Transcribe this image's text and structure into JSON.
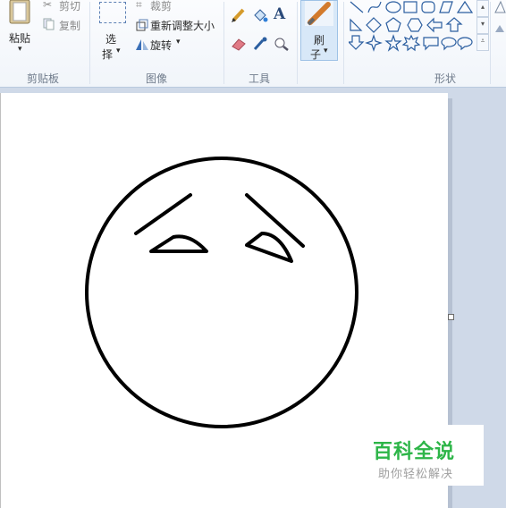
{
  "clipboard": {
    "paste_label": "粘贴",
    "cut_label": "剪切",
    "copy_label": "复制",
    "group_label": "剪贴板"
  },
  "image": {
    "select_label_1": "选",
    "select_label_2": "择",
    "crop_label": "裁剪",
    "resize_label": "重新调整大小",
    "rotate_label": "旋转",
    "group_label": "图像"
  },
  "tools": {
    "group_label": "工具",
    "icons": [
      "pencil-icon",
      "fill-icon",
      "text-icon",
      "eraser-icon",
      "color-picker-icon",
      "magnifier-icon"
    ]
  },
  "brushes": {
    "label_1": "刷",
    "label_2": "子"
  },
  "shapes": {
    "group_label": "形状"
  },
  "watermark": {
    "title": "百科全说",
    "subtitle": "助你轻松解决"
  }
}
